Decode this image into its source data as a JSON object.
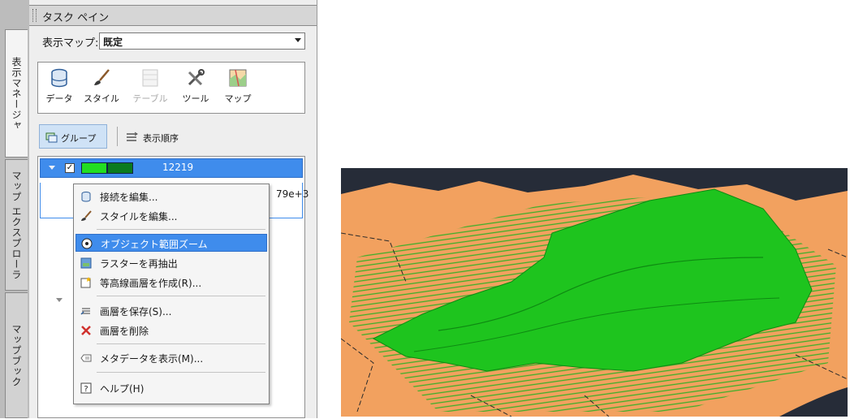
{
  "side_tabs": [
    "表示マネージャ",
    "マップ エクスプローラ",
    "マップブック"
  ],
  "task_pane": {
    "title": "タスク ペイン",
    "display_map_label": "表示マップ:",
    "display_map_value": "既定",
    "tools": [
      {
        "label": "データ",
        "icon": "database-icon",
        "enabled": true
      },
      {
        "label": "スタイル",
        "icon": "brush-icon",
        "enabled": true
      },
      {
        "label": "テーブル",
        "icon": "table-icon",
        "enabled": false
      },
      {
        "label": "ツール",
        "icon": "tools-icon",
        "enabled": true
      },
      {
        "label": "マップ",
        "icon": "map-icon",
        "enabled": true
      }
    ],
    "view_modes": {
      "group": "グループ",
      "draw_order": "表示順序"
    },
    "layer": {
      "name": "12219",
      "checked": true,
      "swatch_colors": [
        "#22dd22",
        "#0a7a1e"
      ],
      "second_row_value": "79e+3"
    }
  },
  "context_menu": {
    "items": [
      {
        "label": "接続を編集...",
        "icon": "database-small-icon"
      },
      {
        "label": "スタイルを編集...",
        "icon": "brush-small-icon"
      },
      {
        "label": "オブジェクト範囲ズーム",
        "icon": "zoom-extents-icon",
        "highlighted": true
      },
      {
        "label": "ラスターを再抽出",
        "icon": "raster-icon"
      },
      {
        "label": "等高線画層を作成(R)...",
        "icon": "contour-icon"
      },
      {
        "label": "画層を保存(S)...",
        "icon": "save-layer-icon"
      },
      {
        "label": "画層を削除",
        "icon": "delete-icon"
      },
      {
        "label": "メタデータを表示(M)...",
        "icon": "metadata-icon"
      },
      {
        "label": "ヘルプ(H)",
        "icon": "help-icon"
      }
    ]
  },
  "colors": {
    "selection": "#3f8cec",
    "terrain": "#1ec41e",
    "land": "#f2a15f",
    "water": "#262c38"
  }
}
